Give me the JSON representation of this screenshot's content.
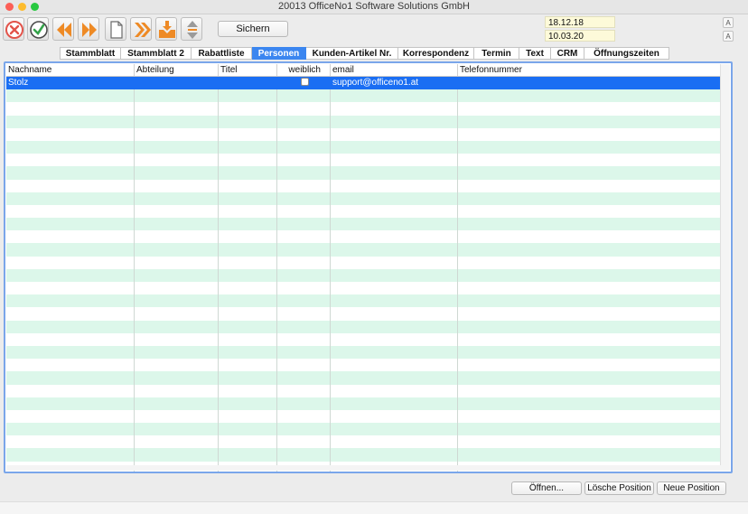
{
  "window": {
    "title": "20013 OfficeNo1 Software Solutions GmbH"
  },
  "toolbar": {
    "icons": [
      "cancel-icon",
      "confirm-icon",
      "previous-icon",
      "next-icon",
      "new-document-icon",
      "forward-icon",
      "inbox-download-icon",
      "sort-updown-icon"
    ],
    "save_label": "Sichern",
    "date1": "18.12.18",
    "date2": "10.03.20",
    "font_increase": "A",
    "font_decrease": "A"
  },
  "tabs": [
    {
      "label": "Stammblatt"
    },
    {
      "label": "Stammblatt 2"
    },
    {
      "label": "Rabattliste"
    },
    {
      "label": "Personen",
      "active": true
    },
    {
      "label": "Kunden-Artikel Nr."
    },
    {
      "label": "Korrespondenz"
    },
    {
      "label": "Termin"
    },
    {
      "label": "Text"
    },
    {
      "label": "CRM"
    },
    {
      "label": "Öffnungszeiten"
    }
  ],
  "table": {
    "columns": [
      "Nachname",
      "Abteilung",
      "Titel",
      "weiblich",
      "email",
      "Telefonnummer"
    ],
    "rows": [
      {
        "nachname": "Stolz",
        "abteilung": "",
        "titel": "",
        "weiblich": false,
        "email": "support@officeno1.at",
        "telefon": "",
        "selected": true
      }
    ],
    "empty_rows": 30
  },
  "buttons": {
    "open": "Öffnen...",
    "delete": "Lösche Position",
    "new": "Neue Position"
  },
  "colors": {
    "accent": "#1a6ef3",
    "row_alt": "#dcf7ea",
    "date_bg": "#fdfad9",
    "icon_orange": "#ee8a25",
    "icon_red": "#e2534a",
    "icon_green": "#35a34b"
  }
}
